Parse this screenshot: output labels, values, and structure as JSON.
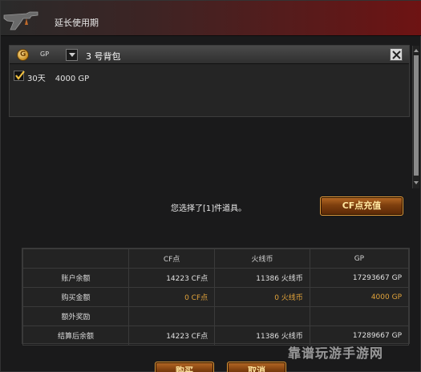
{
  "window": {
    "title": "延长使用期"
  },
  "items_panel": {
    "currency_label": "GP",
    "bag_label": "3 号背包",
    "items": [
      {
        "duration": "30天",
        "price": "4000 GP",
        "checked": true
      }
    ]
  },
  "selection": {
    "text": "您选择了[1]件道具。",
    "topup_button": "CF点充值"
  },
  "summary_table": {
    "headers": [
      "",
      "CF点",
      "火线币",
      "GP"
    ],
    "rows": [
      {
        "label": "账户余额",
        "cf": "14223 CF点",
        "coin": "11386 火线币",
        "gp": "17293667 GP",
        "highlight": false
      },
      {
        "label": "购买金额",
        "cf": "0 CF点",
        "coin": "0 火线币",
        "gp": "4000 GP",
        "highlight": true
      },
      {
        "label": "额外奖励",
        "cf": "",
        "coin": "",
        "gp": "",
        "highlight": false
      },
      {
        "label": "结算后余额",
        "cf": "14223 CF点",
        "coin": "11386 火线币",
        "gp": "17289667 GP",
        "highlight": false
      }
    ]
  },
  "footer": {
    "buy_button": "购买",
    "cancel_button": "取消"
  },
  "watermark": "靠谱玩游手游网"
}
